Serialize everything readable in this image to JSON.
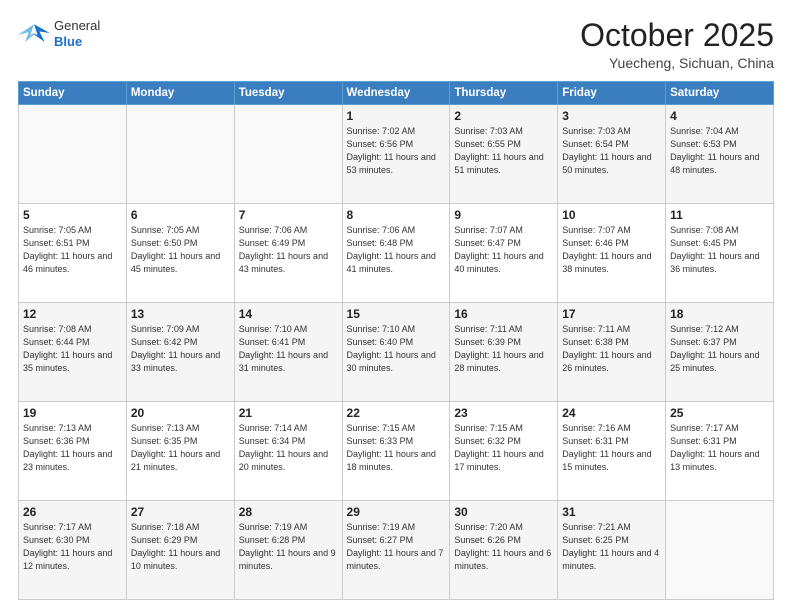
{
  "header": {
    "logo": {
      "general": "General",
      "blue": "Blue"
    },
    "title": "October 2025",
    "subtitle": "Yuecheng, Sichuan, China"
  },
  "weekdays": [
    "Sunday",
    "Monday",
    "Tuesday",
    "Wednesday",
    "Thursday",
    "Friday",
    "Saturday"
  ],
  "weeks": [
    [
      {
        "day": "",
        "sunrise": "",
        "sunset": "",
        "daylight": ""
      },
      {
        "day": "",
        "sunrise": "",
        "sunset": "",
        "daylight": ""
      },
      {
        "day": "",
        "sunrise": "",
        "sunset": "",
        "daylight": ""
      },
      {
        "day": "1",
        "sunrise": "7:02 AM",
        "sunset": "6:56 PM",
        "daylight": "11 hours and 53 minutes."
      },
      {
        "day": "2",
        "sunrise": "7:03 AM",
        "sunset": "6:55 PM",
        "daylight": "11 hours and 51 minutes."
      },
      {
        "day": "3",
        "sunrise": "7:03 AM",
        "sunset": "6:54 PM",
        "daylight": "11 hours and 50 minutes."
      },
      {
        "day": "4",
        "sunrise": "7:04 AM",
        "sunset": "6:53 PM",
        "daylight": "11 hours and 48 minutes."
      }
    ],
    [
      {
        "day": "5",
        "sunrise": "7:05 AM",
        "sunset": "6:51 PM",
        "daylight": "11 hours and 46 minutes."
      },
      {
        "day": "6",
        "sunrise": "7:05 AM",
        "sunset": "6:50 PM",
        "daylight": "11 hours and 45 minutes."
      },
      {
        "day": "7",
        "sunrise": "7:06 AM",
        "sunset": "6:49 PM",
        "daylight": "11 hours and 43 minutes."
      },
      {
        "day": "8",
        "sunrise": "7:06 AM",
        "sunset": "6:48 PM",
        "daylight": "11 hours and 41 minutes."
      },
      {
        "day": "9",
        "sunrise": "7:07 AM",
        "sunset": "6:47 PM",
        "daylight": "11 hours and 40 minutes."
      },
      {
        "day": "10",
        "sunrise": "7:07 AM",
        "sunset": "6:46 PM",
        "daylight": "11 hours and 38 minutes."
      },
      {
        "day": "11",
        "sunrise": "7:08 AM",
        "sunset": "6:45 PM",
        "daylight": "11 hours and 36 minutes."
      }
    ],
    [
      {
        "day": "12",
        "sunrise": "7:08 AM",
        "sunset": "6:44 PM",
        "daylight": "11 hours and 35 minutes."
      },
      {
        "day": "13",
        "sunrise": "7:09 AM",
        "sunset": "6:42 PM",
        "daylight": "11 hours and 33 minutes."
      },
      {
        "day": "14",
        "sunrise": "7:10 AM",
        "sunset": "6:41 PM",
        "daylight": "11 hours and 31 minutes."
      },
      {
        "day": "15",
        "sunrise": "7:10 AM",
        "sunset": "6:40 PM",
        "daylight": "11 hours and 30 minutes."
      },
      {
        "day": "16",
        "sunrise": "7:11 AM",
        "sunset": "6:39 PM",
        "daylight": "11 hours and 28 minutes."
      },
      {
        "day": "17",
        "sunrise": "7:11 AM",
        "sunset": "6:38 PM",
        "daylight": "11 hours and 26 minutes."
      },
      {
        "day": "18",
        "sunrise": "7:12 AM",
        "sunset": "6:37 PM",
        "daylight": "11 hours and 25 minutes."
      }
    ],
    [
      {
        "day": "19",
        "sunrise": "7:13 AM",
        "sunset": "6:36 PM",
        "daylight": "11 hours and 23 minutes."
      },
      {
        "day": "20",
        "sunrise": "7:13 AM",
        "sunset": "6:35 PM",
        "daylight": "11 hours and 21 minutes."
      },
      {
        "day": "21",
        "sunrise": "7:14 AM",
        "sunset": "6:34 PM",
        "daylight": "11 hours and 20 minutes."
      },
      {
        "day": "22",
        "sunrise": "7:15 AM",
        "sunset": "6:33 PM",
        "daylight": "11 hours and 18 minutes."
      },
      {
        "day": "23",
        "sunrise": "7:15 AM",
        "sunset": "6:32 PM",
        "daylight": "11 hours and 17 minutes."
      },
      {
        "day": "24",
        "sunrise": "7:16 AM",
        "sunset": "6:31 PM",
        "daylight": "11 hours and 15 minutes."
      },
      {
        "day": "25",
        "sunrise": "7:17 AM",
        "sunset": "6:31 PM",
        "daylight": "11 hours and 13 minutes."
      }
    ],
    [
      {
        "day": "26",
        "sunrise": "7:17 AM",
        "sunset": "6:30 PM",
        "daylight": "11 hours and 12 minutes."
      },
      {
        "day": "27",
        "sunrise": "7:18 AM",
        "sunset": "6:29 PM",
        "daylight": "11 hours and 10 minutes."
      },
      {
        "day": "28",
        "sunrise": "7:19 AM",
        "sunset": "6:28 PM",
        "daylight": "11 hours and 9 minutes."
      },
      {
        "day": "29",
        "sunrise": "7:19 AM",
        "sunset": "6:27 PM",
        "daylight": "11 hours and 7 minutes."
      },
      {
        "day": "30",
        "sunrise": "7:20 AM",
        "sunset": "6:26 PM",
        "daylight": "11 hours and 6 minutes."
      },
      {
        "day": "31",
        "sunrise": "7:21 AM",
        "sunset": "6:25 PM",
        "daylight": "11 hours and 4 minutes."
      },
      {
        "day": "",
        "sunrise": "",
        "sunset": "",
        "daylight": ""
      }
    ]
  ]
}
